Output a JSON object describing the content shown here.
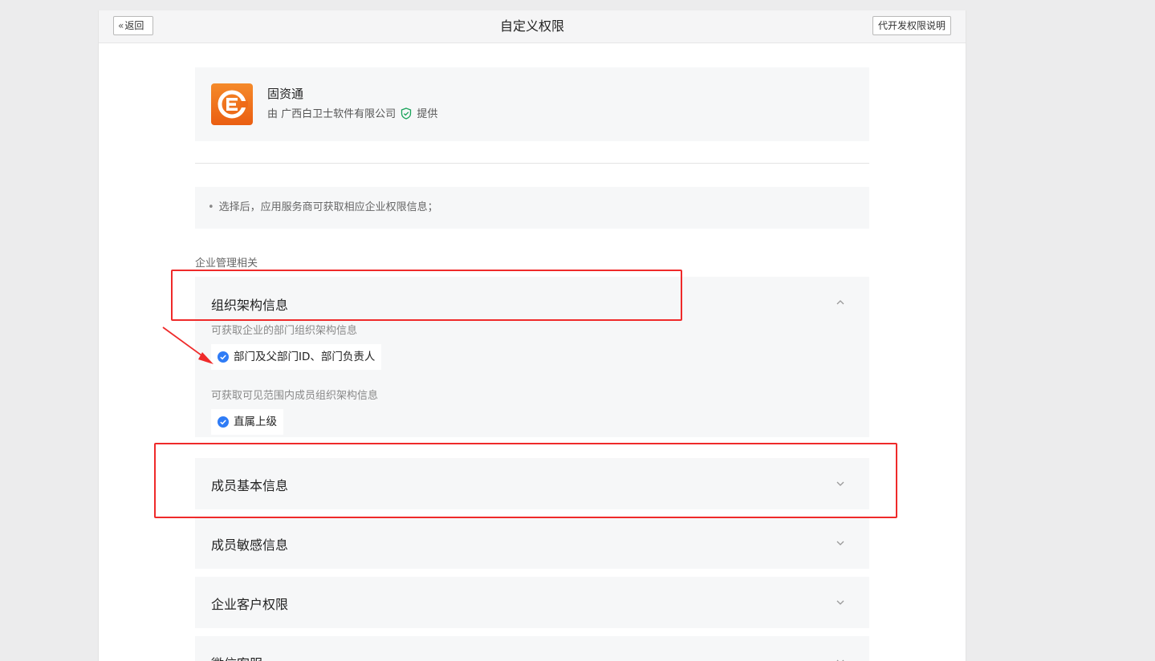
{
  "header": {
    "back_label": "返回",
    "title": "自定义权限",
    "help_label": "代开发权限说明"
  },
  "app": {
    "name": "固资通",
    "provider_prefix": "由 广西白卫士软件有限公司",
    "provider_suffix": "提供"
  },
  "notice": "选择后，应用服务商可获取相应企业权限信息；",
  "section_label": "企业管理相关",
  "permissions": [
    {
      "title": "组织架构信息",
      "expanded": true,
      "groups": [
        {
          "desc": "可获取企业的部门组织架构信息",
          "tags": [
            "部门及父部门ID、部门负责人"
          ]
        },
        {
          "desc": "可获取可见范围内成员组织架构信息",
          "tags": [
            "直属上级"
          ]
        }
      ]
    },
    {
      "title": "成员基本信息",
      "expanded": false
    },
    {
      "title": "成员敏感信息",
      "expanded": false
    },
    {
      "title": "企业客户权限",
      "expanded": false
    },
    {
      "title": "微信客服",
      "expanded": false
    }
  ],
  "colors": {
    "annotation_red": "#ef2a2a",
    "check_blue": "#2f7cf6",
    "logo_orange": "#f27a1f"
  }
}
